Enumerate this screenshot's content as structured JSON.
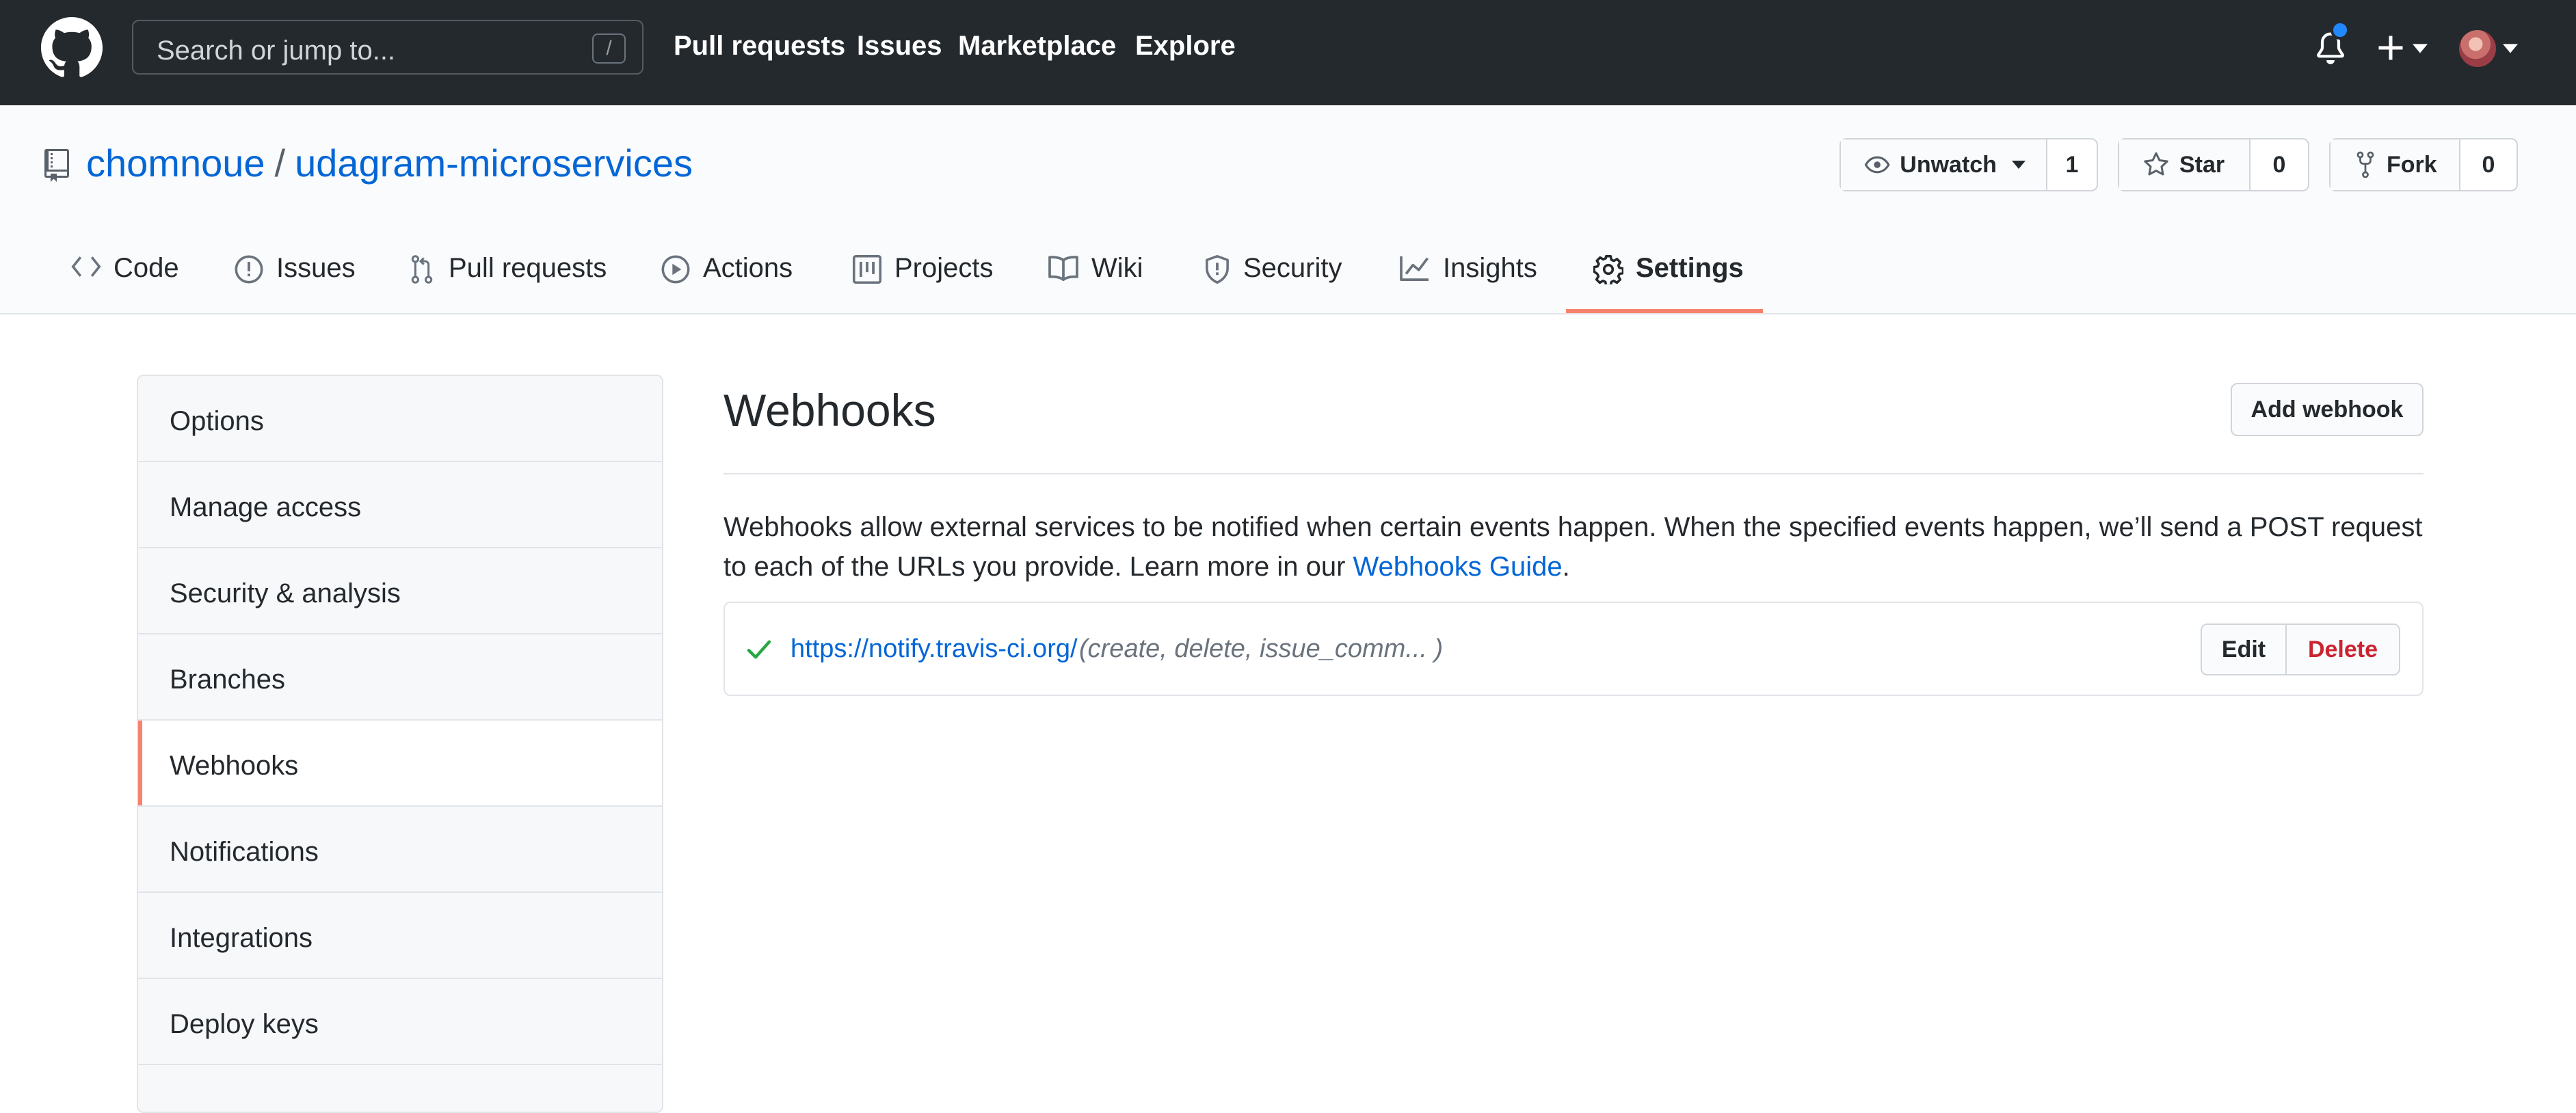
{
  "header": {
    "search_placeholder": "Search or jump to...",
    "search_shortcut": "/",
    "nav": {
      "pull_requests": "Pull requests",
      "issues": "Issues",
      "marketplace": "Marketplace",
      "explore": "Explore"
    },
    "icons": [
      "github-logo",
      "bell-icon",
      "plus-icon",
      "avatar"
    ],
    "notification_dot_color": "#2188ff"
  },
  "repo": {
    "owner": "chomnoue",
    "separator": "/",
    "name": "udagram-microservices",
    "watch_label": "Unwatch",
    "watch_count": "1",
    "star_label": "Star",
    "star_count": "0",
    "fork_label": "Fork",
    "fork_count": "0"
  },
  "tabs": {
    "code": "Code",
    "issues": "Issues",
    "pull_requests": "Pull requests",
    "actions": "Actions",
    "projects": "Projects",
    "wiki": "Wiki",
    "security": "Security",
    "insights": "Insights",
    "settings": "Settings",
    "selected": "settings",
    "selected_underline_color": "#f9826c"
  },
  "sidebar": {
    "items": [
      {
        "label": "Options"
      },
      {
        "label": "Manage access"
      },
      {
        "label": "Security & analysis"
      },
      {
        "label": "Branches"
      },
      {
        "label": "Webhooks"
      },
      {
        "label": "Notifications"
      },
      {
        "label": "Integrations"
      },
      {
        "label": "Deploy keys"
      }
    ],
    "selected": "Webhooks"
  },
  "main": {
    "title": "Webhooks",
    "add_button": "Add webhook",
    "description": "Webhooks allow external services to be notified when certain events happen. When the specified events happen, we’ll send a POST request to each of the URLs you provide. Learn more in our ",
    "guide_link": "Webhooks Guide",
    "description_end": ".",
    "webhook": {
      "status_icon": "check-icon",
      "url": "https://notify.travis-ci.org/",
      "events": "(create, delete, issue_comm... )",
      "edit_label": "Edit",
      "delete_label": "Delete"
    }
  },
  "colors": {
    "header_bg": "#24292e",
    "link": "#0366d6",
    "danger": "#cb2431",
    "success": "#28a745",
    "accent": "#f9826c"
  }
}
